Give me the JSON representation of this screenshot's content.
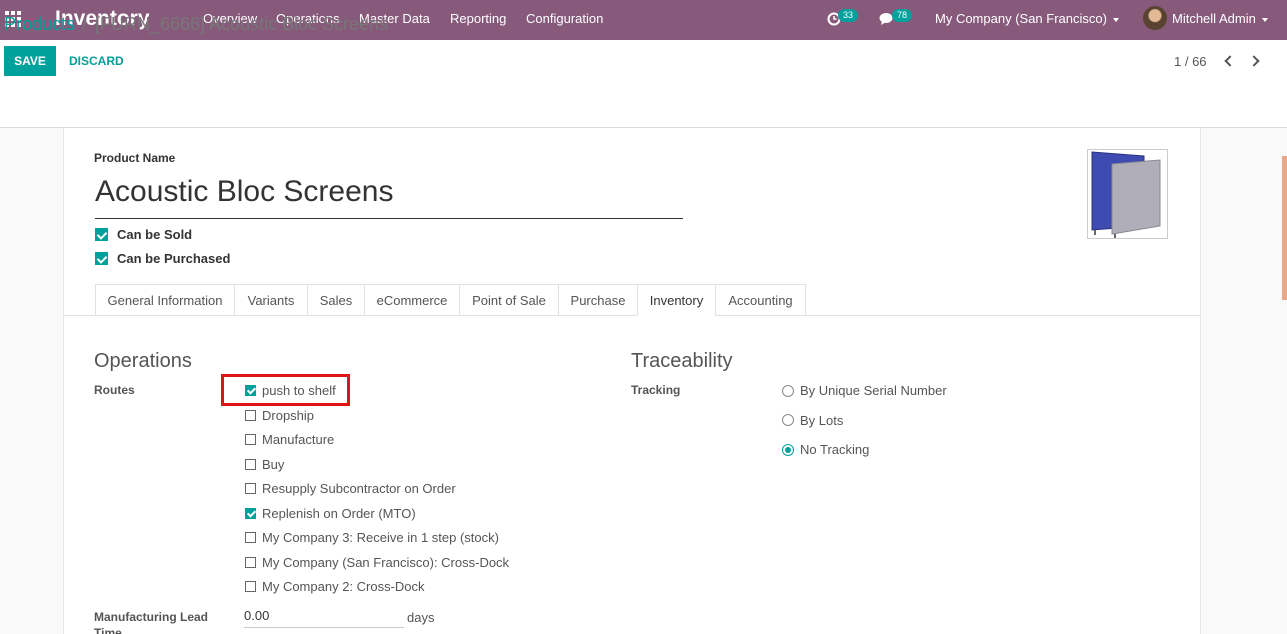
{
  "navbar": {
    "app_title": "Inventory",
    "menu": [
      "Overview",
      "Operations",
      "Master Data",
      "Reporting",
      "Configuration"
    ],
    "activity_count": "33",
    "message_count": "78",
    "company": "My Company (San Francisco)",
    "user": "Mitchell Admin"
  },
  "breadcrumb": {
    "parent": "Products",
    "separator": "/",
    "current": "[FURN_6666] Acoustic Bloc Screens"
  },
  "buttons": {
    "save": "SAVE",
    "discard": "DISCARD"
  },
  "pager": {
    "value": "1 / 66"
  },
  "product": {
    "name_label": "Product Name",
    "name": "Acoustic Bloc Screens",
    "can_be_sold": {
      "label": "Can be Sold",
      "checked": true
    },
    "can_be_purchased": {
      "label": "Can be Purchased",
      "checked": true
    }
  },
  "tabs": [
    "General Information",
    "Variants",
    "Sales",
    "eCommerce",
    "Point of Sale",
    "Purchase",
    "Inventory",
    "Accounting"
  ],
  "active_tab": "Inventory",
  "operations": {
    "title": "Operations",
    "routes_label": "Routes",
    "routes": [
      {
        "label": "push to shelf",
        "checked": true
      },
      {
        "label": "Dropship",
        "checked": false
      },
      {
        "label": "Manufacture",
        "checked": false
      },
      {
        "label": "Buy",
        "checked": false
      },
      {
        "label": "Resupply Subcontractor on Order",
        "checked": false
      },
      {
        "label": "Replenish on Order (MTO)",
        "checked": true
      },
      {
        "label": "My Company 3: Receive in 1 step (stock)",
        "checked": false
      },
      {
        "label": "My Company (San Francisco): Cross-Dock",
        "checked": false
      },
      {
        "label": "My Company 2: Cross-Dock",
        "checked": false
      }
    ],
    "lead_time_label": "Manufacturing Lead Time",
    "lead_time_value": "0.00",
    "lead_time_unit": "days"
  },
  "traceability": {
    "title": "Traceability",
    "tracking_label": "Tracking",
    "options": [
      {
        "label": "By Unique Serial Number",
        "selected": false
      },
      {
        "label": "By Lots",
        "selected": false
      },
      {
        "label": "No Tracking",
        "selected": true
      }
    ]
  },
  "colors": {
    "navbar": "#875a7b",
    "accent": "#00a09d",
    "highlight": "#e01414"
  },
  "icons": [
    "apps-grid-icon",
    "activity-clock-icon",
    "chat-icon",
    "chevron-left-icon",
    "chevron-right-icon"
  ]
}
